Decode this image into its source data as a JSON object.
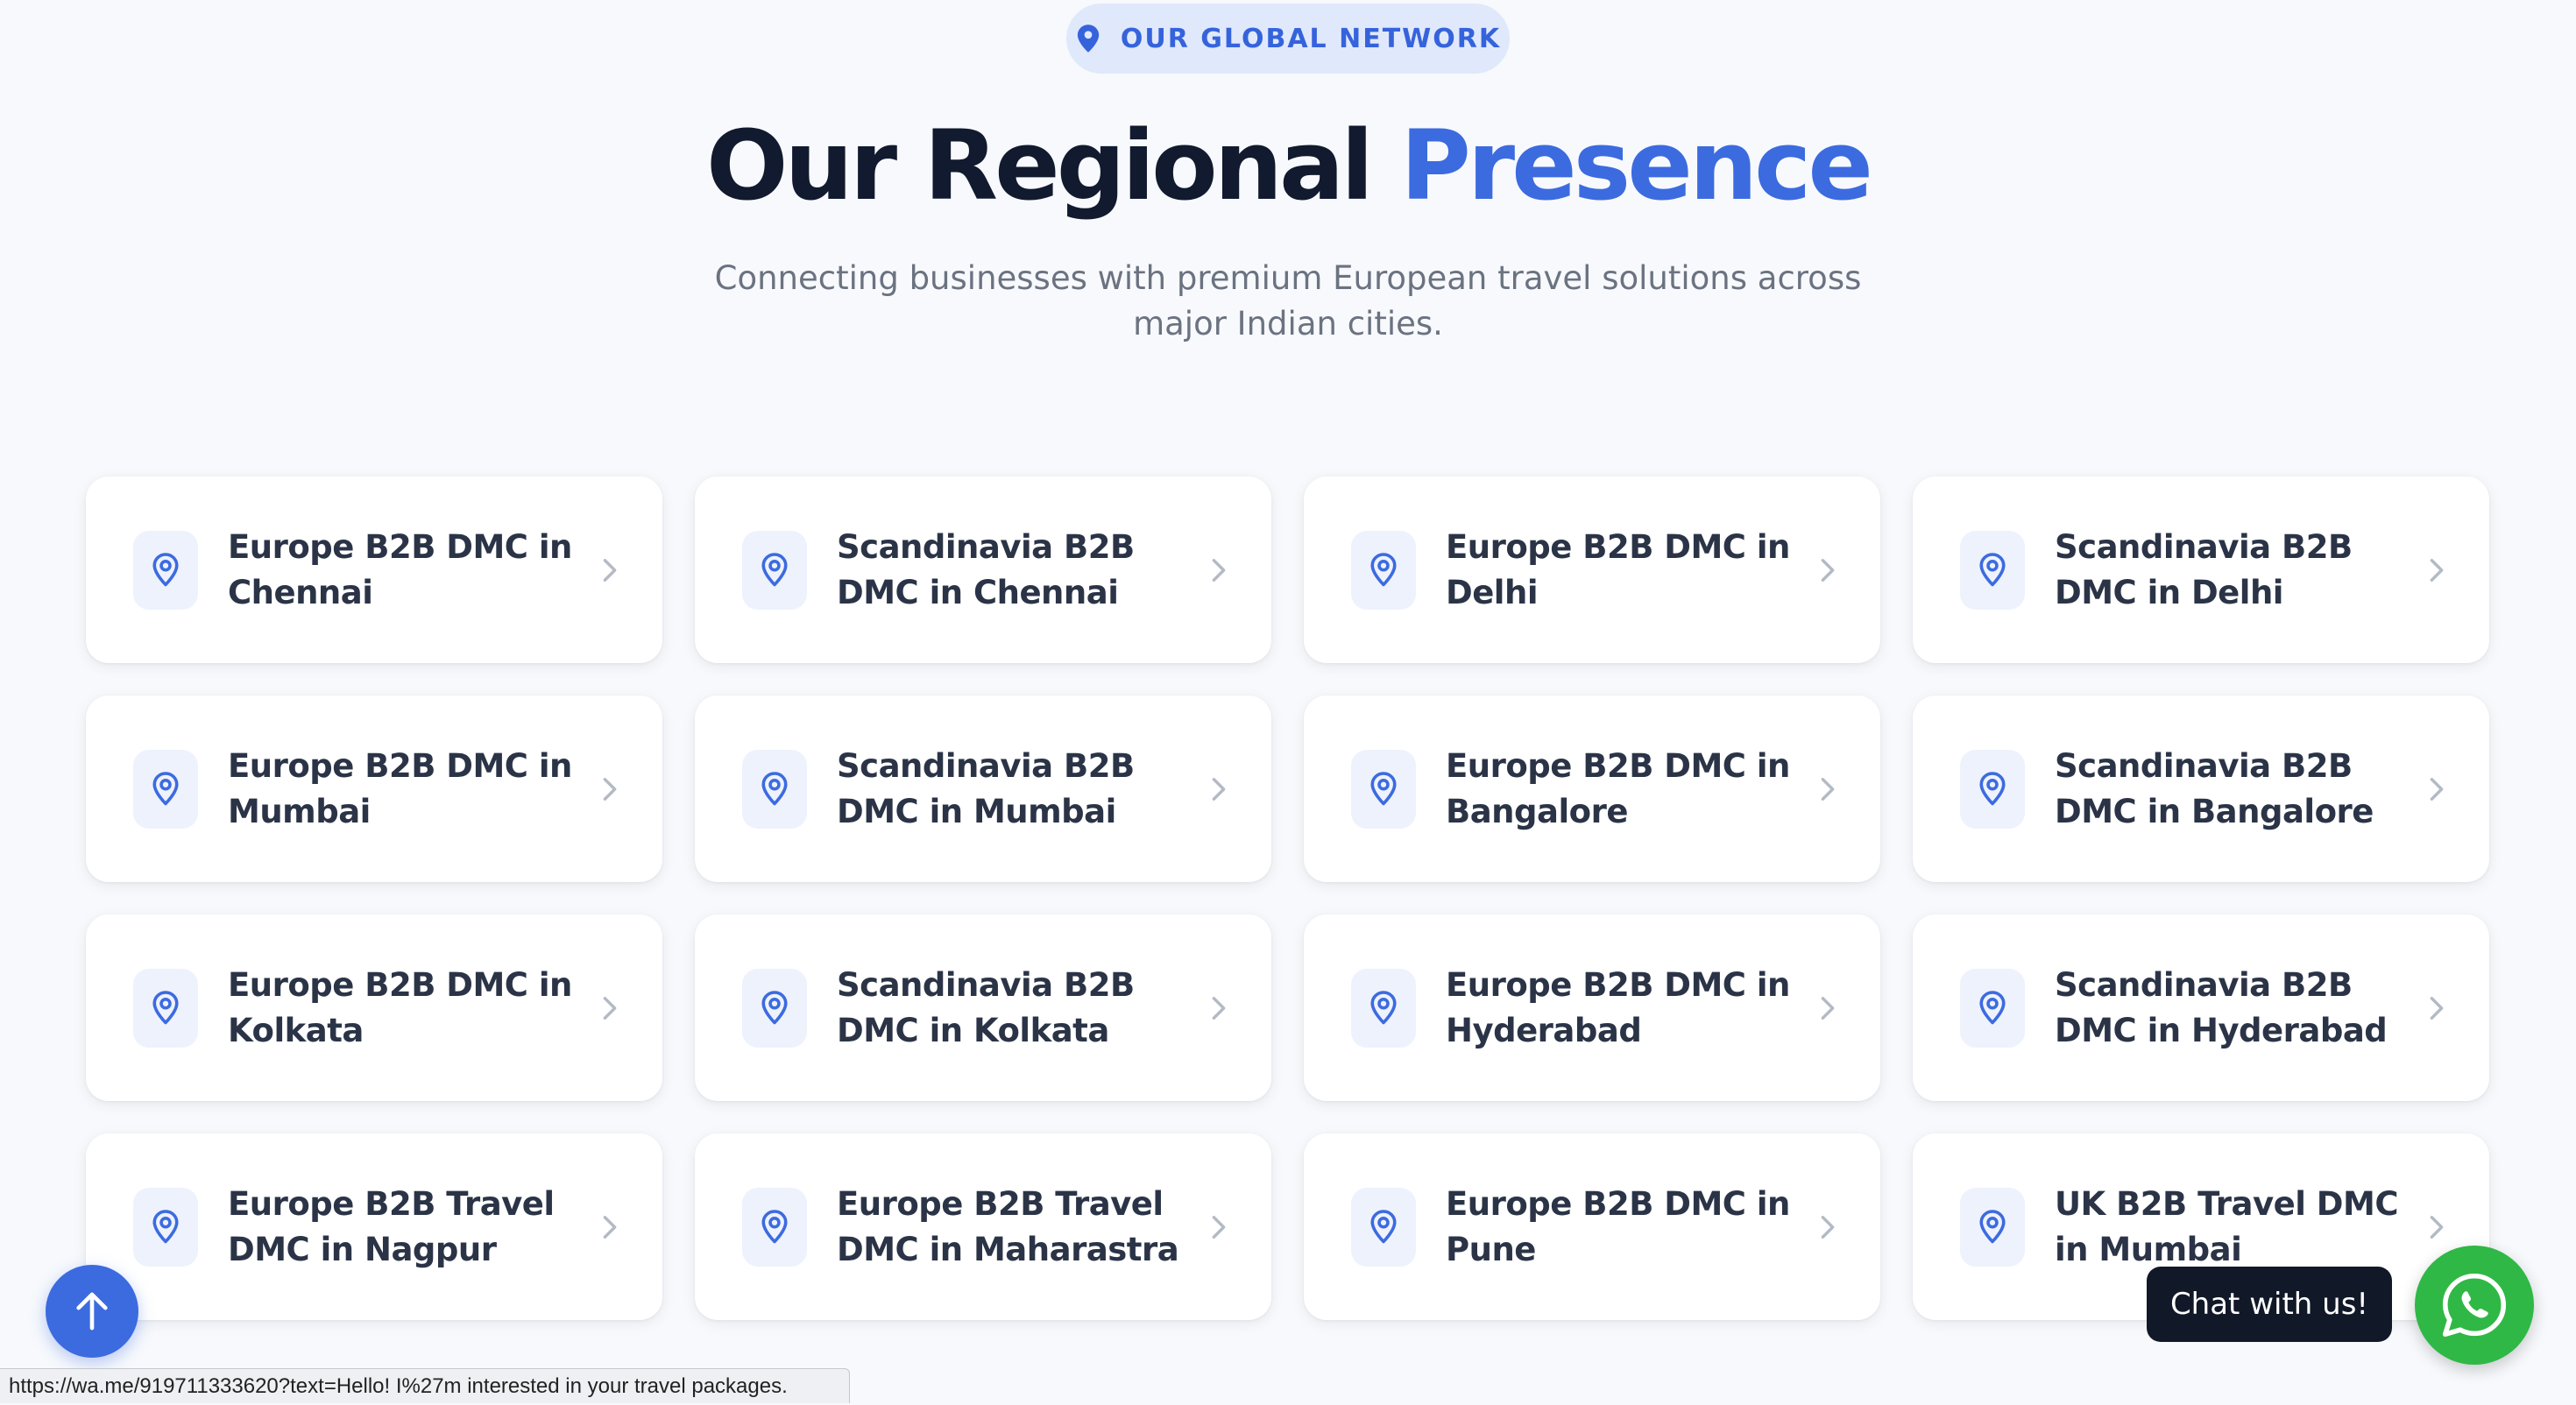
{
  "section_badge": {
    "label": "OUR GLOBAL NETWORK",
    "icon": "map-pin-icon"
  },
  "heading": {
    "main": "Our Regional ",
    "accent": "Presence"
  },
  "subtitle": "Connecting businesses with premium European travel solutions across major Indian cities.",
  "colors": {
    "accent": "#3c6be0",
    "heading": "#111a2e",
    "whatsapp": "#2fb845",
    "background": "#f7f9fc"
  },
  "locations": [
    "Europe B2B DMC in Chennai",
    "Scandinavia B2B DMC in Chennai",
    "Europe B2B DMC in Delhi",
    "Scandinavia B2B DMC in Delhi",
    "Europe B2B DMC in Mumbai",
    "Scandinavia B2B DMC in Mumbai",
    "Europe B2B DMC in Bangalore",
    "Scandinavia B2B DMC in Bangalore",
    "Europe B2B DMC in Kolkata",
    "Scandinavia B2B DMC in Kolkata",
    "Europe B2B DMC in Hyderabad",
    "Scandinavia B2B DMC in Hyderabad",
    "Europe B2B Travel DMC in Nagpur",
    "Europe B2B Travel DMC in Maharastra",
    "Europe B2B DMC in Pune",
    "UK B2B Travel DMC in Mumbai"
  ],
  "chat_tooltip": "Chat with us!",
  "status_bar_url": "https://wa.me/919711333620?text=Hello! I%27m interested in your travel packages."
}
